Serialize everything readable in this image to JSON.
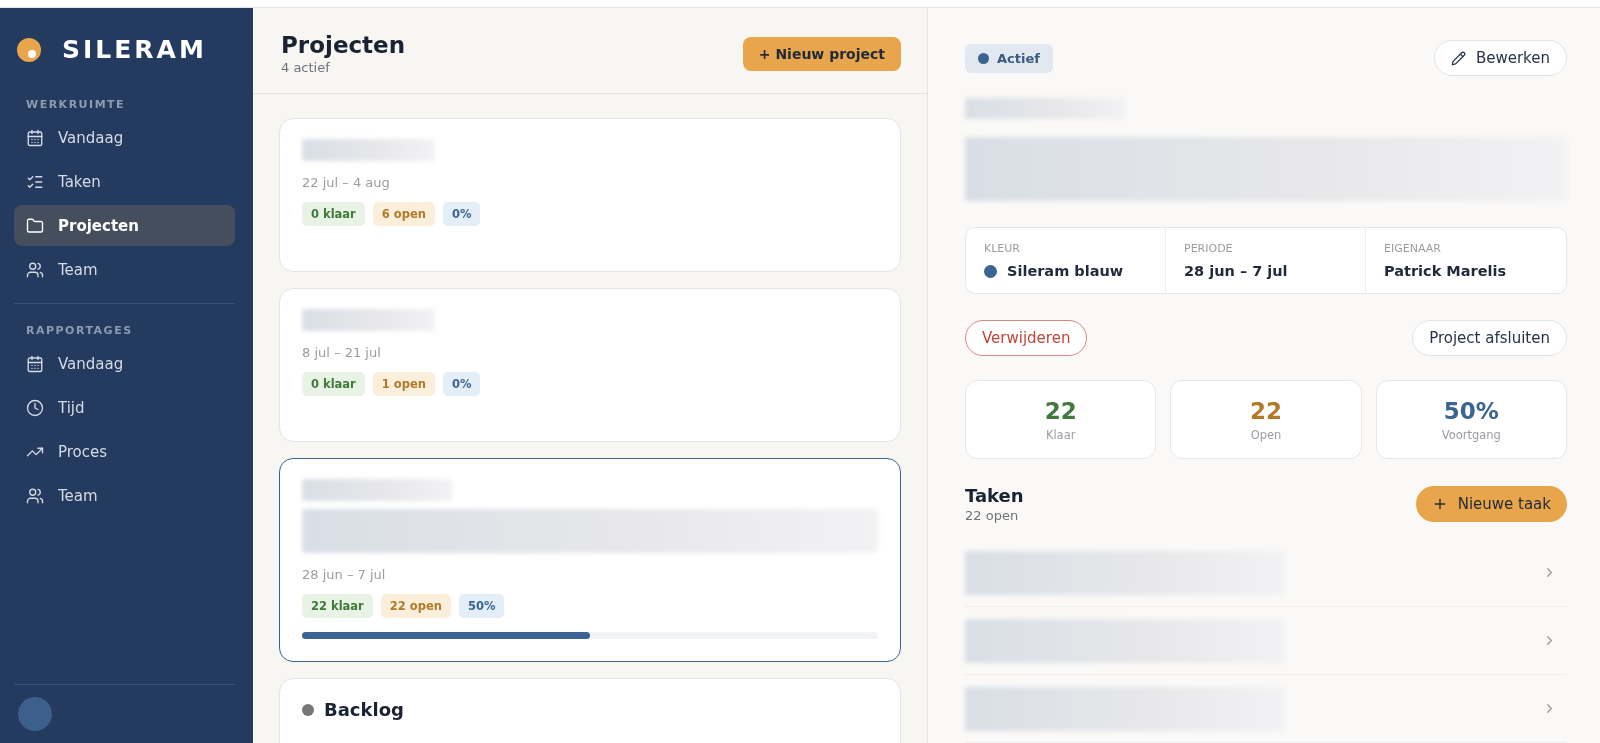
{
  "sidebar": {
    "logo": "SILERAM",
    "sections": [
      {
        "label": "WERKRUIMTE",
        "items": [
          {
            "kind": "calendar",
            "label": "Vandaag",
            "selected": false
          },
          {
            "kind": "checklist",
            "label": "Taken",
            "selected": false
          },
          {
            "kind": "folder",
            "label": "Projecten",
            "selected": true
          },
          {
            "kind": "team",
            "label": "Team",
            "selected": false
          }
        ]
      },
      {
        "label": "RAPPORTAGES",
        "items": [
          {
            "kind": "calendar",
            "label": "Vandaag",
            "selected": false
          },
          {
            "kind": "clock",
            "label": "Tijd",
            "selected": false
          },
          {
            "kind": "trend",
            "label": "Proces",
            "selected": false
          },
          {
            "kind": "team",
            "label": "Team",
            "selected": false
          }
        ]
      }
    ]
  },
  "projects": {
    "title": "Projecten",
    "subtitle": "4 actief",
    "new_button": "+ Nieuw project",
    "cards": [
      {
        "kind": "plain",
        "dates": "22 jul – 4 aug",
        "done": "0 klaar",
        "open": "6 open",
        "progress": "0%",
        "selected": false
      },
      {
        "kind": "plain",
        "dates": "8 jul – 21 jul",
        "done": "0 klaar",
        "open": "1 open",
        "progress": "0%",
        "selected": false
      },
      {
        "kind": "described",
        "dates": "28 jun – 7 jul",
        "done": "22 klaar",
        "open": "22 open",
        "progress": "50%",
        "level": 0.5,
        "selected": true
      },
      {
        "kind": "backlog",
        "title": "Backlog",
        "color": "#777777",
        "selected": false
      }
    ]
  },
  "detail": {
    "status": "Actief",
    "edit_button": "Bewerken",
    "info": [
      {
        "label": "KLEUR",
        "value": "Sileram blauw",
        "color": "#3a6491"
      },
      {
        "label": "PERIODE",
        "value": "28 jun – 7 jul"
      },
      {
        "label": "EIGENAAR",
        "value": "Patrick Marelis"
      }
    ],
    "delete_button": "Verwijderen",
    "close_button": "Project afsluiten",
    "stats": [
      {
        "value": "22",
        "label": "Klaar",
        "color": "#3f7a3a"
      },
      {
        "value": "22",
        "label": "Open",
        "color": "#b07a2a"
      },
      {
        "value": "50%",
        "label": "Voortgang",
        "color": "#3a6491"
      }
    ],
    "tasks": {
      "title": "Taken",
      "subtitle": "22 open",
      "new_button": "Nieuwe taak"
    }
  }
}
